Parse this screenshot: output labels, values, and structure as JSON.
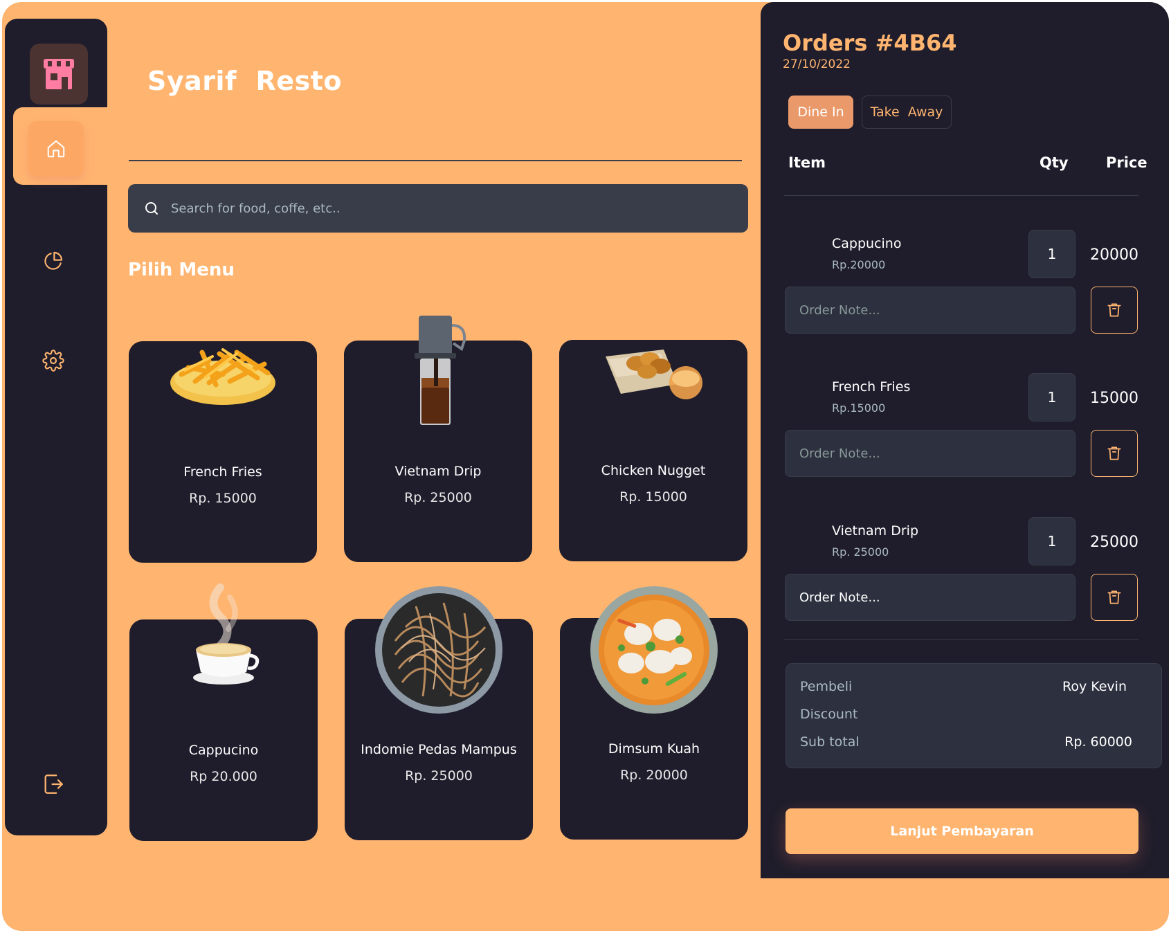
{
  "app": {
    "name": "Syarif  Resto"
  },
  "sidebar": {
    "items": [
      {
        "icon": "home-icon",
        "active": true
      },
      {
        "icon": "dashboard-icon",
        "active": false
      },
      {
        "icon": "settings-icon",
        "active": false
      },
      {
        "icon": "logout-icon",
        "active": false
      }
    ]
  },
  "search": {
    "placeholder": "Search for food, coffe, etc.."
  },
  "menu": {
    "title": "Pilih Menu",
    "items": [
      {
        "name": "French Fries",
        "price": "Rp. 15000"
      },
      {
        "name": "Vietnam Drip",
        "price": "Rp. 25000"
      },
      {
        "name": "Chicken Nugget",
        "price": "Rp. 15000"
      },
      {
        "name": "Cappucino",
        "price": "Rp 20.000"
      },
      {
        "name": "Indomie Pedas Mampus",
        "price": "Rp. 25000"
      },
      {
        "name": "Dimsum Kuah",
        "price": "Rp. 20000"
      }
    ]
  },
  "orders": {
    "title": "Orders #4B64",
    "date": "27/10/2022",
    "types": [
      "Dine In",
      "Take  Away"
    ],
    "columns": {
      "item": "Item",
      "qty": "Qty",
      "price": "Price"
    },
    "items": [
      {
        "name": "Cappucino",
        "unit_price": "Rp.20000",
        "qty": "1",
        "total": "20000",
        "note_placeholder": "Order Note..."
      },
      {
        "name": "French Fries",
        "unit_price": "Rp.15000",
        "qty": "1",
        "total": "15000",
        "note_placeholder": "Order Note..."
      },
      {
        "name": "Vietnam Drip",
        "unit_price": "Rp. 25000",
        "qty": "1",
        "total": "25000",
        "note_placeholder": "Order Note..."
      }
    ],
    "summary": {
      "buyer_label": "Pembeli",
      "buyer": "Roy Kevin",
      "discount_label": "Discount",
      "discount": "",
      "subtotal_label": "Sub total",
      "subtotal": "Rp. 60000"
    },
    "pay_label": "Lanjut Pembayaran"
  },
  "colors": {
    "background": "#FFB570",
    "panel": "#1F1D2B",
    "field": "#2D303E",
    "accent": "#FFB570",
    "accent_active": "#EA9A6A"
  }
}
